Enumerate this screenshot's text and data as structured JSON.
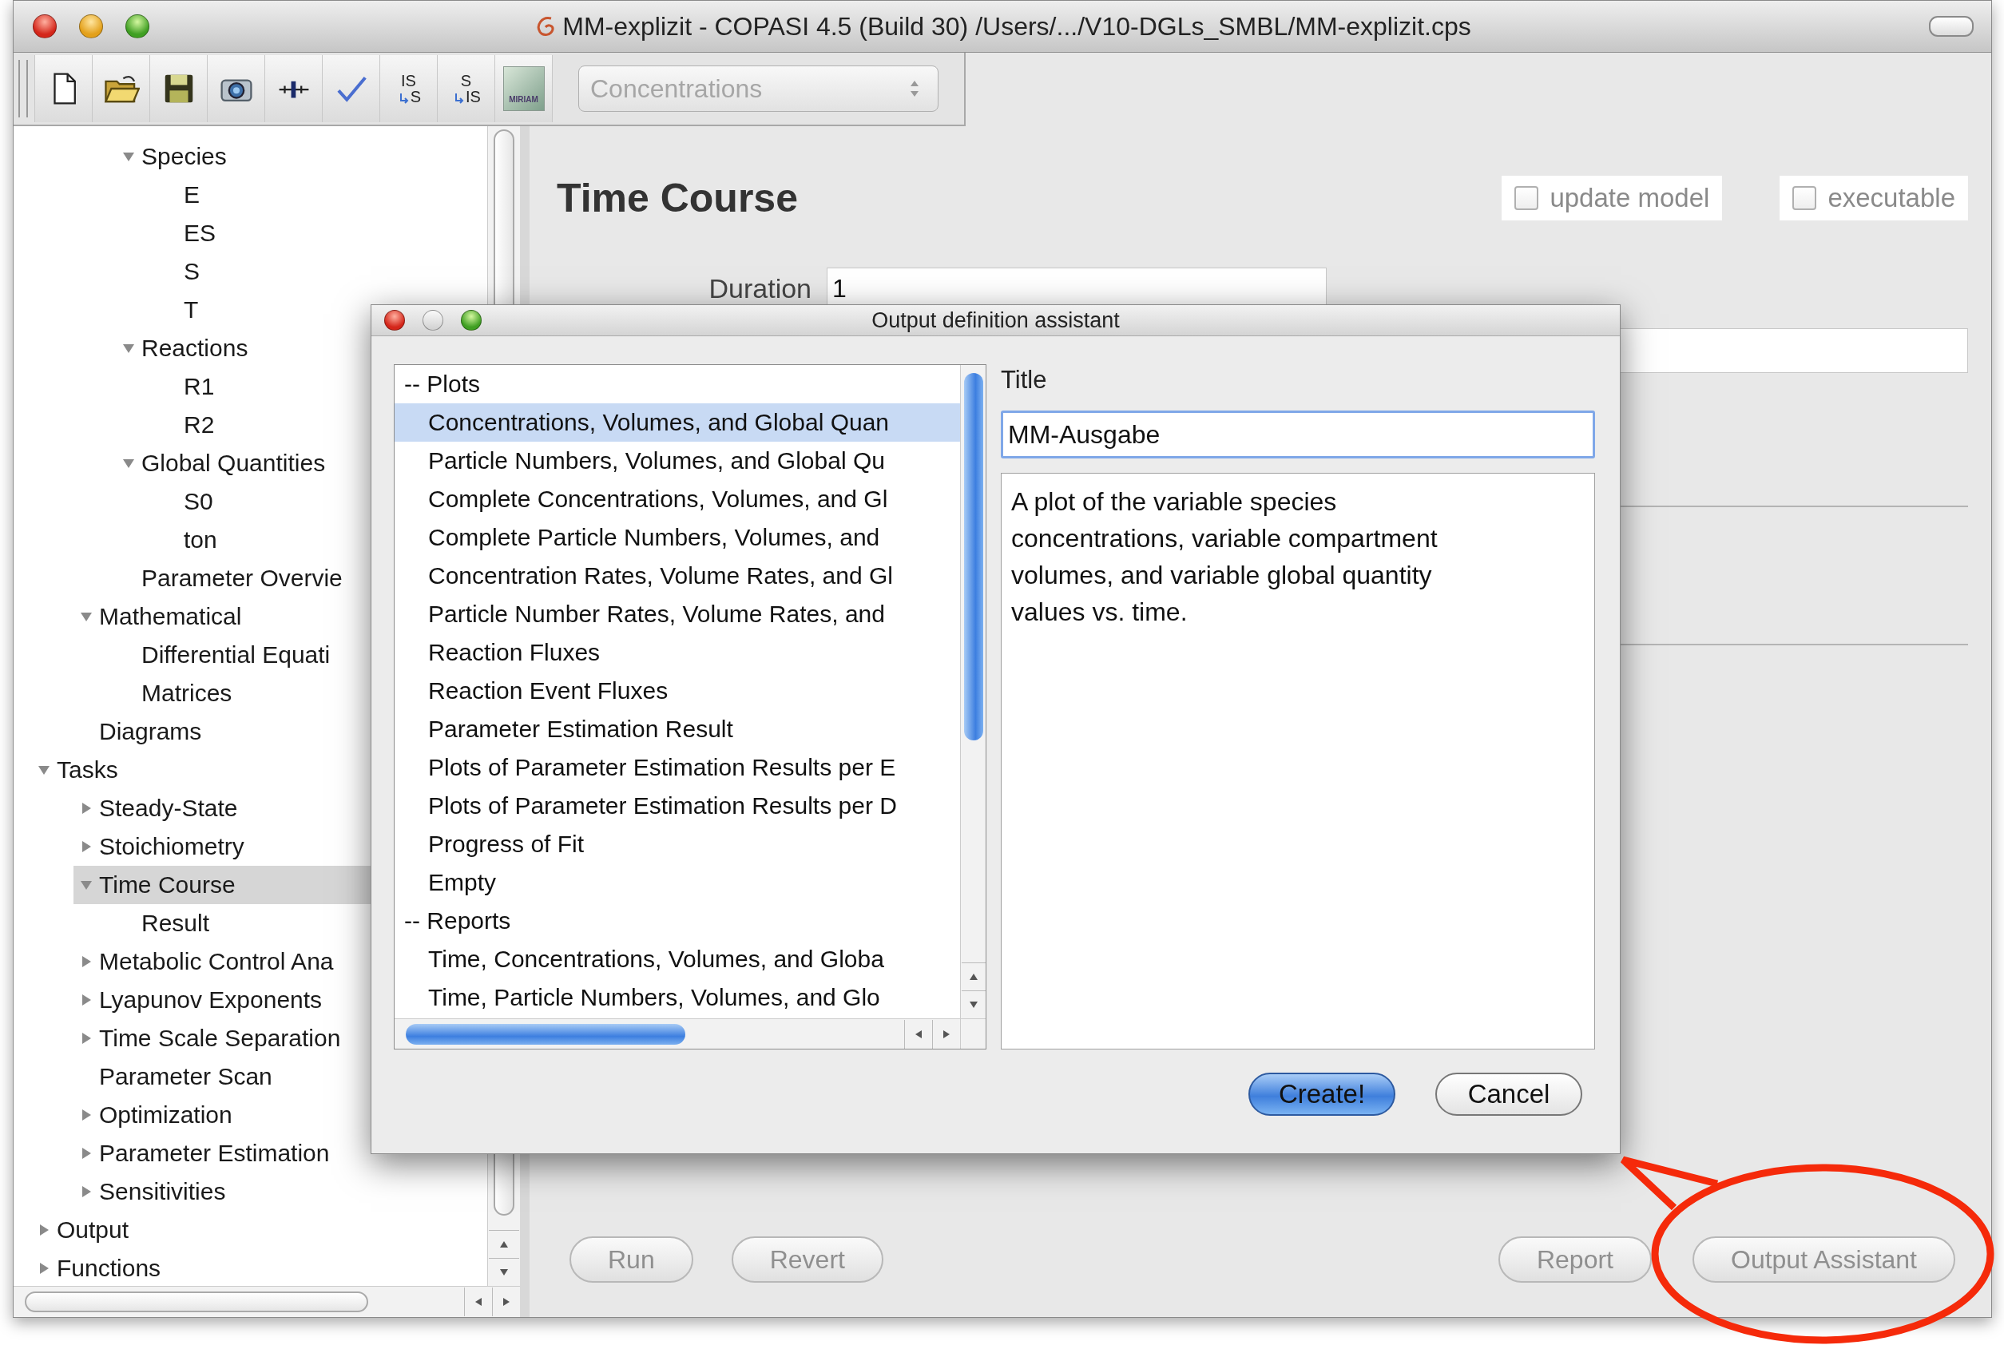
{
  "window": {
    "title": "MM-explizit - COPASI 4.5 (Build 30) /Users/.../V10-DGLs_SMBL/MM-explizit.cps"
  },
  "toolbar": {
    "buttons": [
      {
        "kind": "page"
      },
      {
        "kind": "folder"
      },
      {
        "kind": "disk"
      },
      {
        "kind": "camera"
      },
      {
        "kind": "slider"
      },
      {
        "kind": "check"
      },
      {
        "kind": "convert",
        "top": "IS",
        "bottom": "S"
      },
      {
        "kind": "convert",
        "top": "S",
        "bottom": "IS"
      },
      {
        "kind": "badge",
        "label": "MIRIAM"
      }
    ],
    "dropdown": {
      "value": "Concentrations",
      "disabled": true
    }
  },
  "tree": [
    {
      "children": [
        {
          "children": [
            {
              "label": "Species",
              "expanded": true,
              "selected": false,
              "children": [
                {
                  "label": "E",
                  "selected": false
                },
                {
                  "label": "ES",
                  "selected": false
                },
                {
                  "label": "S",
                  "selected": false
                },
                {
                  "label": "T",
                  "selected": false
                }
              ]
            },
            {
              "label": "Reactions",
              "expanded": true,
              "selected": false,
              "children": [
                {
                  "label": "R1",
                  "selected": false
                },
                {
                  "label": "R2",
                  "selected": false
                }
              ]
            },
            {
              "label": "Global Quantities",
              "expanded": true,
              "selected": false,
              "children": [
                {
                  "label": "S0",
                  "selected": false
                },
                {
                  "label": "ton",
                  "selected": false
                }
              ]
            },
            {
              "label": "Parameter Overvie",
              "selected": false
            }
          ]
        },
        {
          "label": "Mathematical",
          "expanded": true,
          "selected": false,
          "children": [
            {
              "label": "Differential Equati",
              "selected": false
            },
            {
              "label": "Matrices",
              "selected": false
            }
          ]
        },
        {
          "label": "Diagrams",
          "selected": false
        }
      ]
    },
    {
      "label": "Tasks",
      "expanded": true,
      "selected": false,
      "children": [
        {
          "label": "Steady-State",
          "expanded": false,
          "selected": false
        },
        {
          "label": "Stoichiometry",
          "expanded": false,
          "selected": false
        },
        {
          "label": "Time Course",
          "expanded": true,
          "selected": true,
          "children": [
            {
              "label": "Result",
              "selected": false
            }
          ]
        },
        {
          "label": "Metabolic Control Ana",
          "expanded": false,
          "selected": false
        },
        {
          "label": "Lyapunov Exponents",
          "expanded": false,
          "selected": false
        },
        {
          "label": "Time Scale Separation",
          "expanded": false,
          "selected": false
        },
        {
          "label": "Parameter Scan",
          "selected": false
        },
        {
          "label": "Optimization",
          "expanded": false,
          "selected": false
        },
        {
          "label": "Parameter Estimation",
          "expanded": false,
          "selected": false
        },
        {
          "label": "Sensitivities",
          "expanded": false,
          "selected": false
        }
      ]
    },
    {
      "label": "Output",
      "expanded": false,
      "selected": false
    },
    {
      "label": "Functions",
      "expanded": false,
      "selected": false
    }
  ],
  "task": {
    "title": "Time Course",
    "checkboxes": [
      {
        "label": "update model",
        "checked": false
      },
      {
        "label": "executable",
        "checked": false
      }
    ],
    "duration": {
      "label": "Duration",
      "value": "1"
    },
    "run_buttons": [
      {
        "label": "Run",
        "disabled": true
      },
      {
        "label": "Revert",
        "disabled": true
      }
    ],
    "output_buttons": [
      {
        "label": "Report",
        "disabled": true
      },
      {
        "label": "Output Assistant",
        "disabled": true
      }
    ]
  },
  "dialog": {
    "title": "Output definition assistant",
    "items": [
      {
        "kind": "header",
        "label": "-- Plots",
        "selected": false
      },
      {
        "kind": "item",
        "label": "Concentrations, Volumes, and Global Quan",
        "selected": true
      },
      {
        "kind": "item",
        "label": "Particle Numbers, Volumes, and Global Qu",
        "selected": false
      },
      {
        "kind": "item",
        "label": "Complete Concentrations, Volumes, and Gl",
        "selected": false
      },
      {
        "kind": "item",
        "label": "Complete Particle Numbers, Volumes, and",
        "selected": false
      },
      {
        "kind": "item",
        "label": "Concentration Rates, Volume Rates, and Gl",
        "selected": false
      },
      {
        "kind": "item",
        "label": "Particle Number Rates, Volume Rates, and",
        "selected": false
      },
      {
        "kind": "item",
        "label": "Reaction Fluxes",
        "selected": false
      },
      {
        "kind": "item",
        "label": "Reaction Event Fluxes",
        "selected": false
      },
      {
        "kind": "item",
        "label": "Parameter Estimation Result",
        "selected": false
      },
      {
        "kind": "item",
        "label": "Plots of Parameter Estimation Results per E",
        "selected": false
      },
      {
        "kind": "item",
        "label": "Plots of Parameter Estimation Results per D",
        "selected": false
      },
      {
        "kind": "item",
        "label": "Progress of Fit",
        "selected": false
      },
      {
        "kind": "item",
        "label": "Empty",
        "selected": false
      },
      {
        "kind": "header",
        "label": "-- Reports",
        "selected": false
      },
      {
        "kind": "item",
        "label": "Time, Concentrations, Volumes, and Globa",
        "selected": false
      },
      {
        "kind": "item",
        "label": "Time, Particle Numbers, Volumes, and Glo",
        "selected": false
      }
    ],
    "title_label": "Title",
    "title_value": "MM-Ausgabe",
    "description": "A plot of the variable species concentrations, variable compartment volumes, and variable global quantity values vs. time.",
    "buttons": [
      {
        "label": "Create!",
        "default": true
      },
      {
        "label": "Cancel",
        "default": false
      }
    ]
  }
}
